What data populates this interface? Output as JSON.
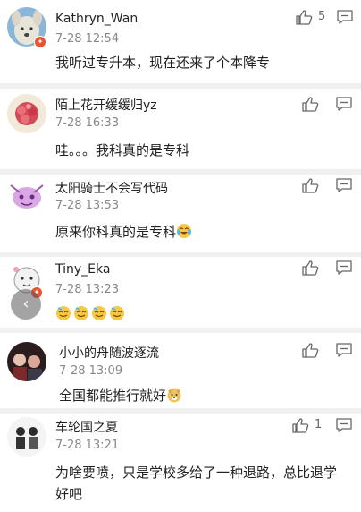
{
  "comments": [
    {
      "name": "Kathryn_Wan",
      "time": "7-28 12:54",
      "text": "我听过专升本，现在还来了个本降专",
      "likes": "5"
    },
    {
      "name": "陌上花开缓缓归yz",
      "time": "7-28 16:33",
      "text": "哇。。。我科真的是专科",
      "likes": ""
    },
    {
      "name": "太阳骑士不会写代码",
      "time": "7-28 13:53",
      "text": "原来你科真的是专科",
      "likes": ""
    },
    {
      "name": "Tiny_Eka",
      "time": "7-28 13:23",
      "text": "",
      "likes": ""
    },
    {
      "name": "小小的舟随波逐流",
      "time": "7-28 13:09",
      "text": "全国都能推行就好",
      "likes": ""
    },
    {
      "name": "车轮国之夏",
      "time": "7-28 13:21",
      "text": "为啥要喷，只是学校多给了一种退路，总比退学好吧",
      "likes": "1"
    }
  ],
  "icons": {
    "like": "thumbs-up-icon",
    "reply": "comment-icon",
    "back": "chevron-left-icon"
  },
  "colors": {
    "badge": "#e8542f",
    "divider": "#f0f0f0"
  }
}
